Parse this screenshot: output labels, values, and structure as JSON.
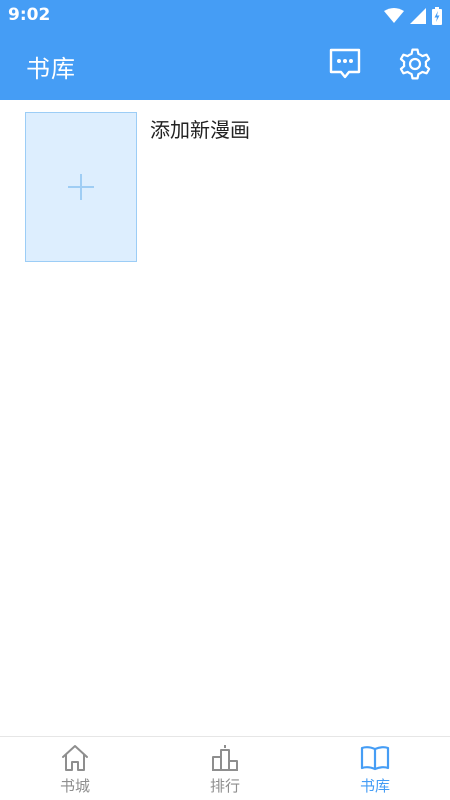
{
  "status_bar": {
    "time": "9:02",
    "icons": [
      "wifi-icon",
      "cell-signal-icon",
      "battery-charging-icon"
    ]
  },
  "app_bar": {
    "title": "书库",
    "actions": [
      "message-icon",
      "gear-icon"
    ]
  },
  "library": {
    "add_item_label": "添加新漫画",
    "add_icon": "plus-icon"
  },
  "bottom_nav": {
    "items": [
      {
        "label": "书城",
        "icon": "home-icon",
        "active": false
      },
      {
        "label": "排行",
        "icon": "ranking-icon",
        "active": false
      },
      {
        "label": "书库",
        "icon": "book-open-icon",
        "active": true
      }
    ]
  },
  "colors": {
    "primary": "#459df5",
    "cover_fill": "#ddeefe",
    "cover_border": "#9ccdf6",
    "nav_inactive": "#8e8e8e"
  }
}
